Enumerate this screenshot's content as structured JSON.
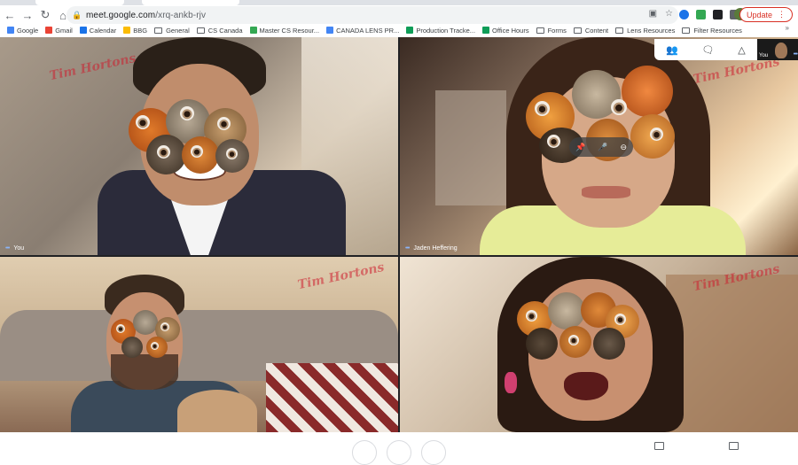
{
  "browser": {
    "url_host": "meet.google.com",
    "url_path": "/xrq-ankb-rjv",
    "update_label": "Update",
    "nav_icons": [
      "back-icon",
      "forward-icon",
      "reload-icon",
      "home-icon"
    ],
    "omnibox_icons": [
      "camera-icon",
      "star-icon"
    ],
    "extension_icons": [
      "extension-blue-icon",
      "extension-green-icon",
      "extension-dark-icon",
      "puzzle-icon"
    ]
  },
  "bookmarks": [
    {
      "label": "Google",
      "icon": "google-icon",
      "color": "#4285f4"
    },
    {
      "label": "Gmail",
      "icon": "gmail-icon",
      "color": "#ea4335"
    },
    {
      "label": "Calendar",
      "icon": "calendar-icon",
      "color": "#1a73e8"
    },
    {
      "label": "BBG",
      "icon": "bbg-icon",
      "color": "#fbbc04"
    },
    {
      "label": "General",
      "icon": "folder-icon",
      "color": "#5f6368"
    },
    {
      "label": "CS Canada",
      "icon": "folder-icon",
      "color": "#5f6368"
    },
    {
      "label": "Master CS Resour...",
      "icon": "drive-icon",
      "color": "#34a853"
    },
    {
      "label": "CANADA LENS PR...",
      "icon": "bookmark-blue-icon",
      "color": "#4285f4"
    },
    {
      "label": "Production Tracke...",
      "icon": "sheets-icon",
      "color": "#0f9d58"
    },
    {
      "label": "Office Hours",
      "icon": "sheets-icon",
      "color": "#0f9d58"
    },
    {
      "label": "Forms",
      "icon": "folder-icon",
      "color": "#5f6368"
    },
    {
      "label": "Content",
      "icon": "folder-icon",
      "color": "#5f6368"
    },
    {
      "label": "Lens Resources",
      "icon": "folder-icon",
      "color": "#5f6368"
    },
    {
      "label": "Filter Resources",
      "icon": "folder-icon",
      "color": "#5f6368"
    }
  ],
  "bookmarks_more": "»",
  "meet": {
    "brand_text": "Tim Hortons",
    "participants": [
      {
        "name": "You"
      },
      {
        "name": "Jaden Heffering"
      },
      {
        "name": ""
      },
      {
        "name": ""
      }
    ],
    "self_view_label": "You",
    "panel_icons": [
      "people-icon",
      "chat-icon",
      "activities-icon"
    ],
    "pip_icons": [
      "pin-icon",
      "mic-icon",
      "remove-icon"
    ]
  },
  "colors": {
    "accent_red": "#d93025",
    "meet_bg": "#202124",
    "brand_red": "#ce1e2d"
  }
}
